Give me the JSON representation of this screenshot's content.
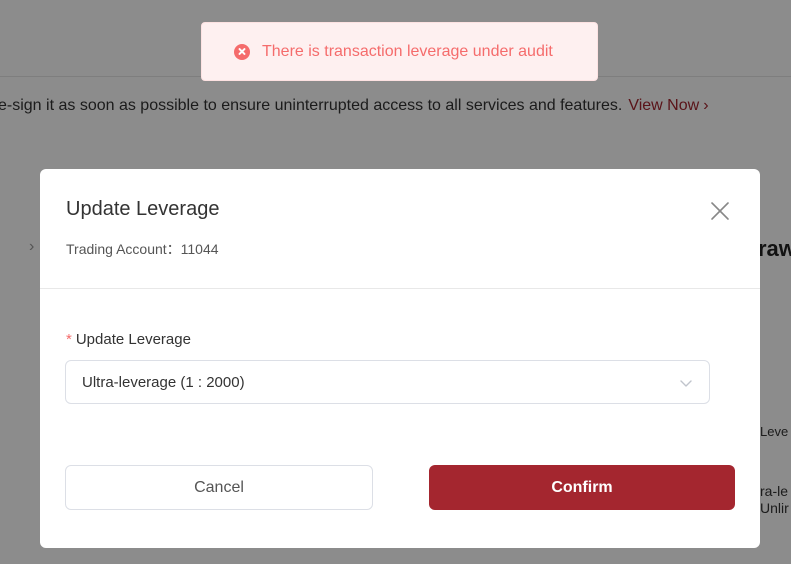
{
  "toast": {
    "message": "There is transaction leverage under audit",
    "icon": "error-circle-icon",
    "color": "#f56c6c"
  },
  "background": {
    "notice_text": "e-sign it as soon as possible to ensure uninterrupted access to all services and features.",
    "view_now_label": "View Now",
    "chevron": "›",
    "heading_fragment": "raw",
    "level_fragment": "Leve",
    "ultra_fragment_1": "ra-le",
    "ultra_fragment_2": "Unlir"
  },
  "modal": {
    "title": "Update Leverage",
    "subtitle": "Trading Account：11044",
    "field": {
      "required_mark": "*",
      "label": "Update Leverage",
      "selected_value": "Ultra-leverage (1 : 2000)"
    },
    "cancel_label": "Cancel",
    "confirm_label": "Confirm"
  },
  "colors": {
    "brand": "#a4262f",
    "error": "#f56c6c",
    "toast_bg": "#fef0f0"
  }
}
